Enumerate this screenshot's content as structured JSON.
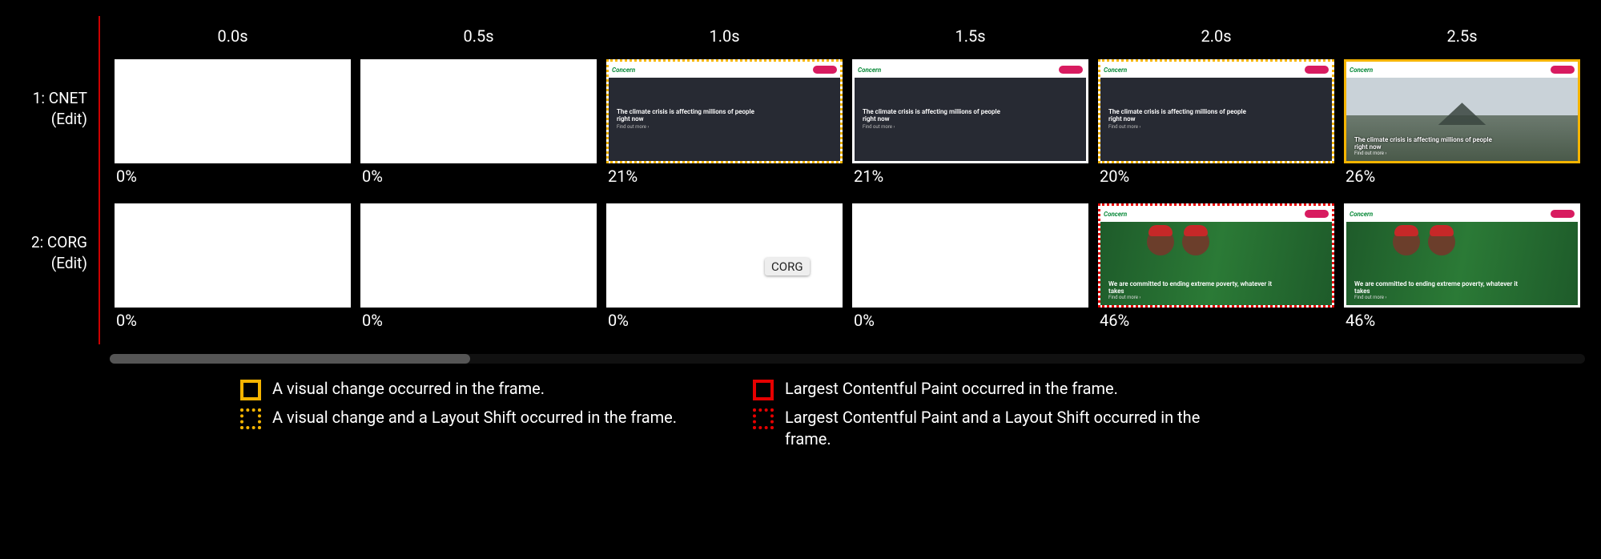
{
  "timeHeaders": [
    "0.0s",
    "0.5s",
    "1.0s",
    "1.5s",
    "2.0s",
    "2.5s"
  ],
  "rows": [
    {
      "id": "cnet",
      "label_line1": "1: CNET",
      "label_line2": "(Edit)",
      "frames": [
        {
          "border": "",
          "pct": "0%",
          "content": "blank"
        },
        {
          "border": "",
          "pct": "0%",
          "content": "blank"
        },
        {
          "border": "visual-dotted",
          "pct": "21%",
          "content": "dark"
        },
        {
          "border": "",
          "pct": "21%",
          "content": "dark"
        },
        {
          "border": "visual-dotted",
          "pct": "20%",
          "content": "dark"
        },
        {
          "border": "visual-solid",
          "pct": "26%",
          "content": "image"
        }
      ],
      "miniText": {
        "logo": "Concern",
        "h1_dark": "The climate crisis is affecting millions of people right now",
        "sub": "Find out more ›",
        "h1_dark2": "The climate crisis is affecting millions of people right now",
        "h1_img": "The climate crisis is affecting millions of people right now"
      }
    },
    {
      "id": "corg",
      "label_line1": "2: CORG",
      "label_line2": "(Edit)",
      "frames": [
        {
          "border": "",
          "pct": "0%",
          "content": "blank"
        },
        {
          "border": "",
          "pct": "0%",
          "content": "blank"
        },
        {
          "border": "",
          "pct": "0%",
          "content": "blank"
        },
        {
          "border": "",
          "pct": "0%",
          "content": "blank"
        },
        {
          "border": "lcp-dotted",
          "pct": "46%",
          "content": "green"
        },
        {
          "border": "",
          "pct": "46%",
          "content": "green"
        }
      ],
      "miniText": {
        "logo": "Concern",
        "h1_green": "We are committed to ending extreme poverty, whatever it takes",
        "sub": "Find out more ›"
      }
    }
  ],
  "tooltip": "CORG",
  "legend": {
    "y_solid": "A visual change occurred in the frame.",
    "y_dotted": "A visual change and a Layout Shift occurred in the frame.",
    "r_solid": "Largest Contentful Paint occurred in the frame.",
    "r_dotted": "Largest Contentful Paint and a Layout Shift occurred in the frame."
  }
}
